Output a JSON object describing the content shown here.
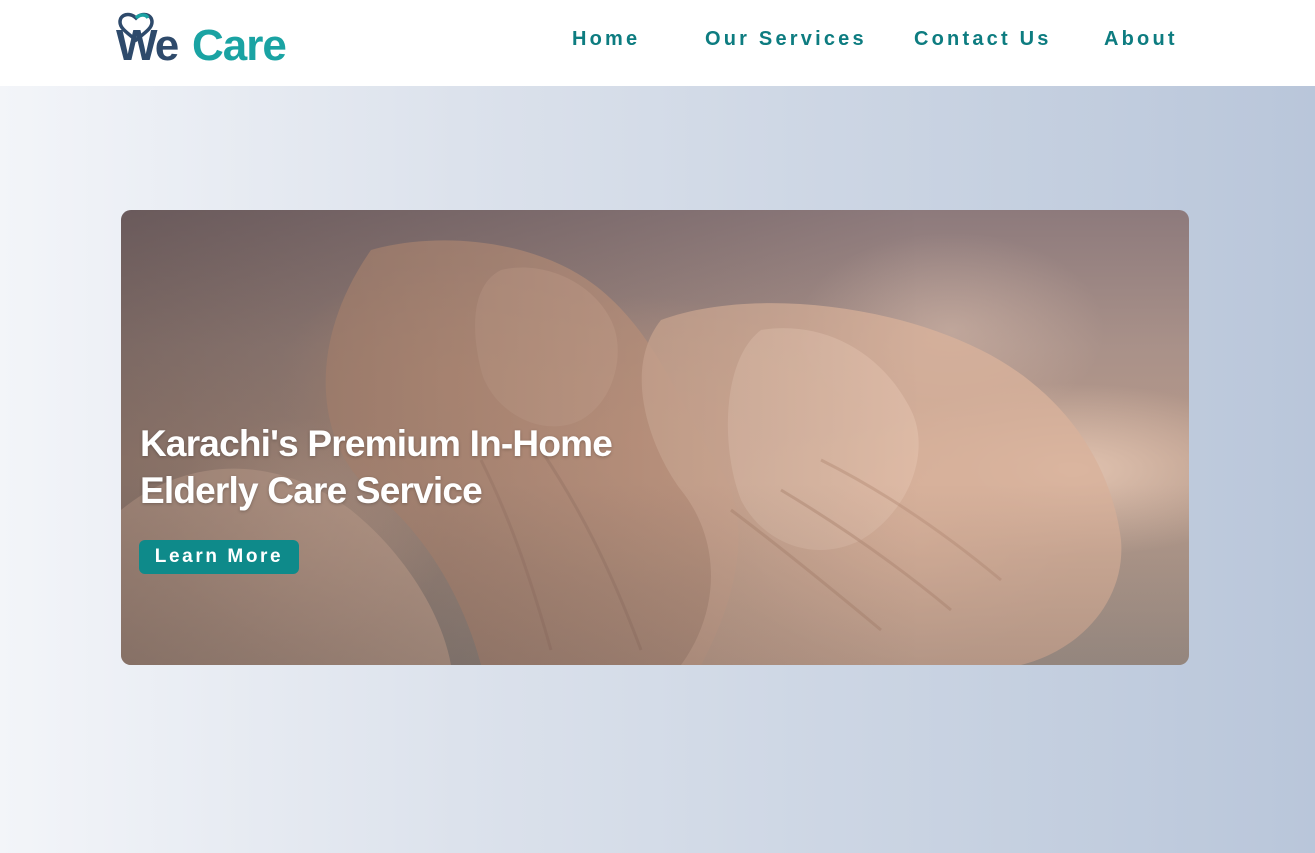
{
  "brand": {
    "logo_text_we": "We",
    "logo_text_care": "Care",
    "colors": {
      "we": "#2e4a6b",
      "care": "#1aa3a3"
    }
  },
  "nav": {
    "items": [
      {
        "label": "Home"
      },
      {
        "label": "Our Services"
      },
      {
        "label": "Contact Us"
      },
      {
        "label": "About"
      }
    ],
    "color": "#0d7c80"
  },
  "hero": {
    "title_line1": "Karachi's Premium In-Home",
    "title_line2": "Elderly Care Service",
    "button_label": "Learn More",
    "button_color": "#0e8a8a",
    "image_alt": "elderly-hands-held-icon"
  }
}
